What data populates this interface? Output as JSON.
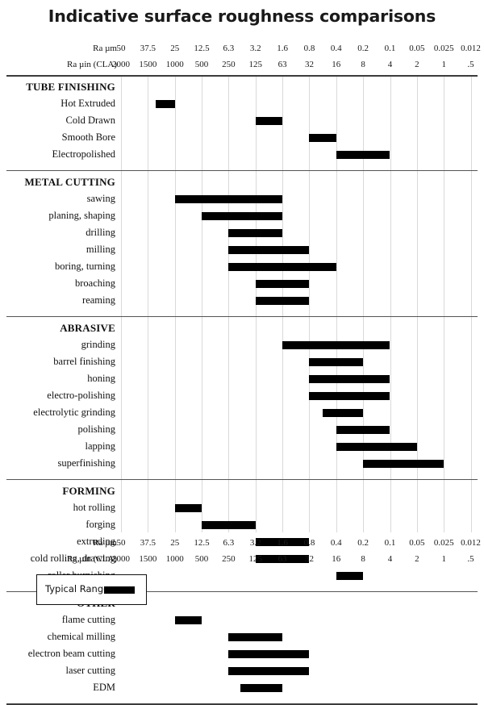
{
  "title": "Indicative surface roughness comparisons",
  "axis": {
    "unit_label_primary": "Ra µm",
    "unit_label_secondary": "Ra µin (CLA)",
    "ra_um": [
      "50",
      "37.5",
      "25",
      "12.5",
      "6.3",
      "3.2",
      "1.6",
      "0.8",
      "0.4",
      "0.2",
      "0.1",
      "0.05",
      "0.025",
      "0.012"
    ],
    "ra_uin": [
      "2000",
      "1500",
      "1000",
      "500",
      "250",
      "125",
      "63",
      "32",
      "16",
      "8",
      "4",
      "2",
      "1",
      ".5"
    ]
  },
  "legend": {
    "label": "Typical Range",
    "swatch_color": "#000000"
  },
  "colors": {
    "bar": "#000000",
    "gridline": "#d9d9d9",
    "section_rule": "#555555",
    "text": "#111111"
  },
  "chart_data": {
    "type": "bar",
    "title": "Indicative surface roughness comparisons",
    "xlabel": "Ra µm",
    "ylabel": "",
    "orientation": "horizontal",
    "note": "Horizontal range (floating) bar chart. Each bar spans the typical surface roughness range for a process. The x axis is a discrete, evenly spaced sequence of Ra values descending from 50 µm to 0.012 µm (column index 0..13).",
    "x_axis_categories": [
      "50",
      "37.5",
      "25",
      "12.5",
      "6.3",
      "3.2",
      "1.6",
      "0.8",
      "0.4",
      "0.2",
      "0.1",
      "0.05",
      "0.025",
      "0.012"
    ],
    "x_axis_secondary_categories": [
      "2000",
      "1500",
      "1000",
      "500",
      "250",
      "125",
      "63",
      "32",
      "16",
      "8",
      "4",
      "2",
      "1",
      ".5"
    ],
    "sections": [
      {
        "name": "TUBE FINISHING",
        "rows": [
          {
            "label": "Hot Extruded",
            "start_um": "37.5",
            "end_um": "25",
            "start_index": 1.3,
            "end_index": 2.0
          },
          {
            "label": "Cold Drawn",
            "start_um": "3.2",
            "end_um": "1.6",
            "start_index": 5.0,
            "end_index": 6.0
          },
          {
            "label": "Smooth Bore",
            "start_um": "0.8",
            "end_um": "0.4",
            "start_index": 7.0,
            "end_index": 8.0
          },
          {
            "label": "Electropolished",
            "start_um": "0.4",
            "end_um": "0.1",
            "start_index": 8.0,
            "end_index": 10.0
          }
        ]
      },
      {
        "name": "METAL CUTTING",
        "rows": [
          {
            "label": "sawing",
            "start_um": "25",
            "end_um": "1.6",
            "start_index": 2.0,
            "end_index": 6.0
          },
          {
            "label": "planing, shaping",
            "start_um": "12.5",
            "end_um": "1.6",
            "start_index": 3.0,
            "end_index": 6.0
          },
          {
            "label": "drilling",
            "start_um": "6.3",
            "end_um": "1.6",
            "start_index": 4.0,
            "end_index": 6.0
          },
          {
            "label": "milling",
            "start_um": "6.3",
            "end_um": "0.8",
            "start_index": 4.0,
            "end_index": 7.0
          },
          {
            "label": "boring, turning",
            "start_um": "6.3",
            "end_um": "0.4",
            "start_index": 4.0,
            "end_index": 8.0
          },
          {
            "label": "broaching",
            "start_um": "3.2",
            "end_um": "0.8",
            "start_index": 5.0,
            "end_index": 7.0
          },
          {
            "label": "reaming",
            "start_um": "3.2",
            "end_um": "0.8",
            "start_index": 5.0,
            "end_index": 7.0
          }
        ]
      },
      {
        "name": "ABRASIVE",
        "rows": [
          {
            "label": "grinding",
            "start_um": "1.6",
            "end_um": "0.1",
            "start_index": 6.0,
            "end_index": 10.0
          },
          {
            "label": "barrel finishing",
            "start_um": "0.8",
            "end_um": "0.2",
            "start_index": 7.0,
            "end_index": 9.0
          },
          {
            "label": "honing",
            "start_um": "0.8",
            "end_um": "0.1",
            "start_index": 7.0,
            "end_index": 10.0
          },
          {
            "label": "electro-polishing",
            "start_um": "0.8",
            "end_um": "0.1",
            "start_index": 7.0,
            "end_index": 10.0
          },
          {
            "label": "electrolytic grinding",
            "start_um": "0.6",
            "end_um": "0.2",
            "start_index": 7.5,
            "end_index": 9.0
          },
          {
            "label": "polishing",
            "start_um": "0.4",
            "end_um": "0.1",
            "start_index": 8.0,
            "end_index": 10.0
          },
          {
            "label": "lapping",
            "start_um": "0.4",
            "end_um": "0.05",
            "start_index": 8.0,
            "end_index": 11.0
          },
          {
            "label": "superfinishing",
            "start_um": "0.2",
            "end_um": "0.025",
            "start_index": 9.0,
            "end_index": 12.0
          }
        ]
      },
      {
        "name": "FORMING",
        "rows": [
          {
            "label": "hot rolling",
            "start_um": "25",
            "end_um": "12.5",
            "start_index": 2.0,
            "end_index": 3.0
          },
          {
            "label": "forging",
            "start_um": "12.5",
            "end_um": "3.2",
            "start_index": 3.0,
            "end_index": 5.0
          },
          {
            "label": "extruding",
            "start_um": "3.2",
            "end_um": "0.8",
            "start_index": 5.0,
            "end_index": 7.0
          },
          {
            "label": "cold rolling, drawing",
            "start_um": "3.2",
            "end_um": "0.8",
            "start_index": 5.0,
            "end_index": 7.0
          },
          {
            "label": "roller burnishing",
            "start_um": "0.4",
            "end_um": "0.2",
            "start_index": 8.0,
            "end_index": 9.0
          }
        ]
      },
      {
        "name": "OTHER",
        "rows": [
          {
            "label": "flame cutting",
            "start_um": "25",
            "end_um": "12.5",
            "start_index": 2.0,
            "end_index": 3.0
          },
          {
            "label": "chemical milling",
            "start_um": "6.3",
            "end_um": "1.6",
            "start_index": 4.0,
            "end_index": 6.0
          },
          {
            "label": "electron beam cutting",
            "start_um": "6.3",
            "end_um": "0.8",
            "start_index": 4.0,
            "end_index": 7.0
          },
          {
            "label": "laser cutting",
            "start_um": "6.3",
            "end_um": "0.8",
            "start_index": 4.0,
            "end_index": 7.0
          },
          {
            "label": "EDM",
            "start_um": "4.5",
            "end_um": "1.6",
            "start_index": 4.45,
            "end_index": 6.0
          }
        ]
      }
    ]
  }
}
